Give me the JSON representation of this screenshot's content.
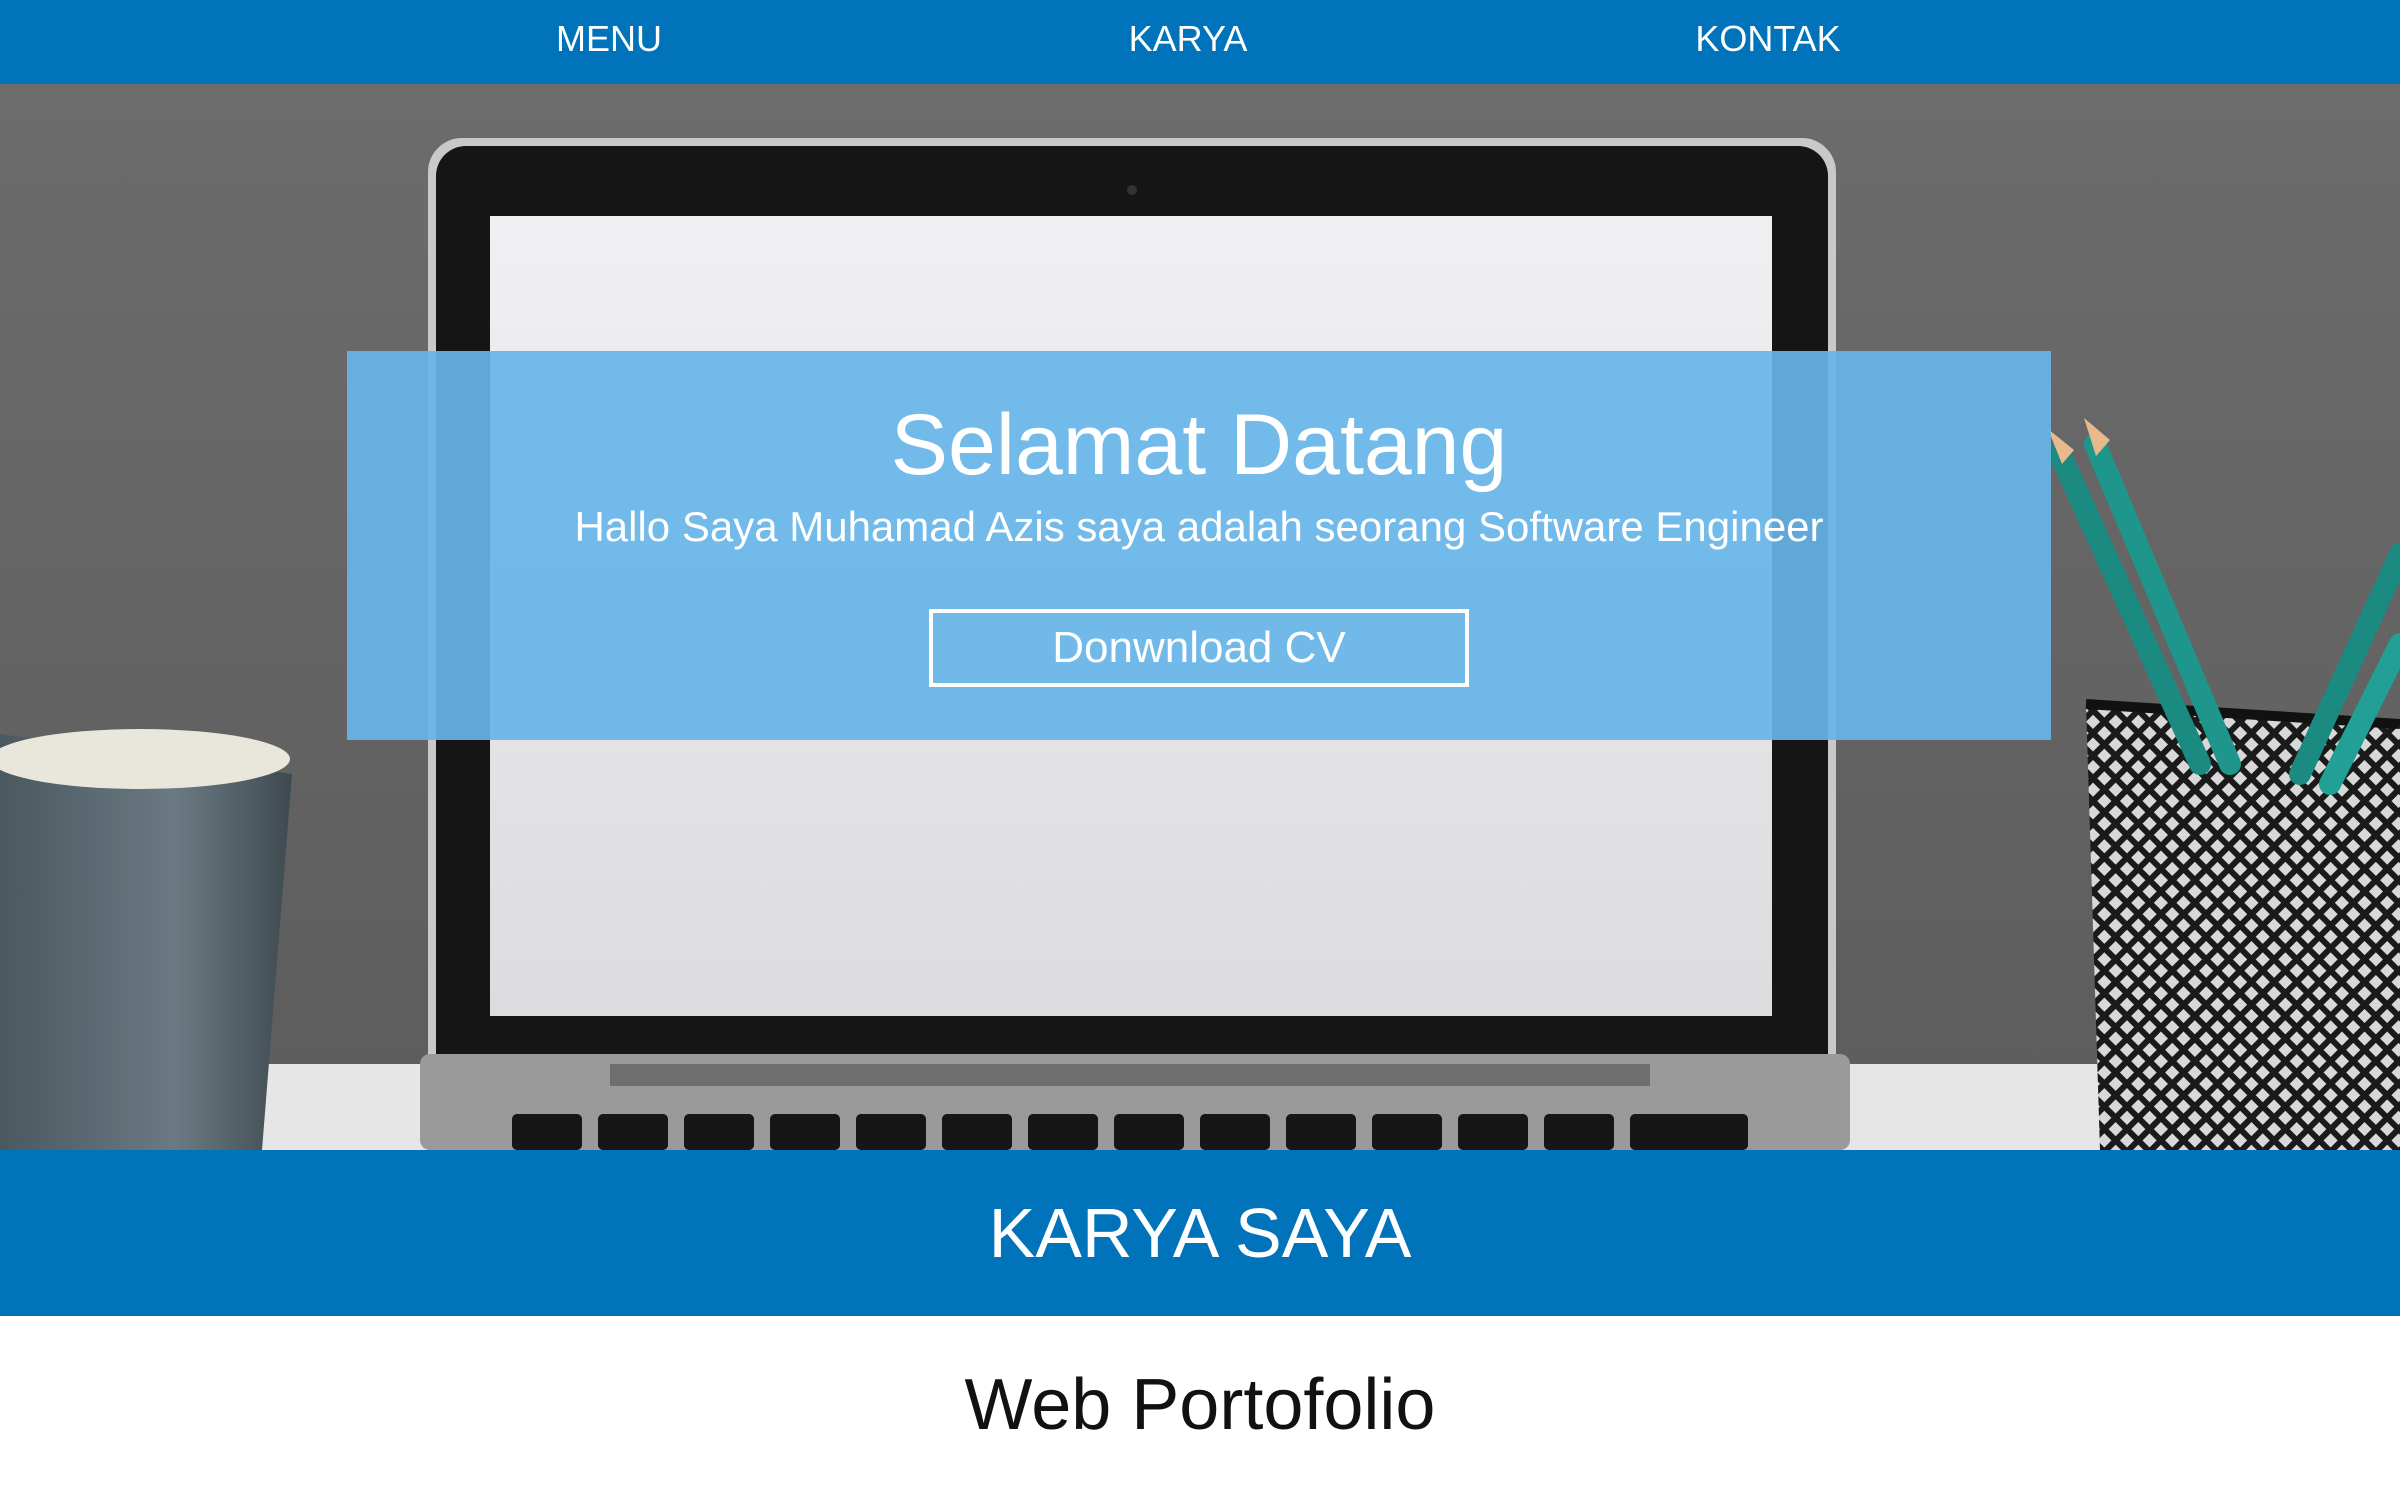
{
  "nav": {
    "items": [
      {
        "label": "MENU"
      },
      {
        "label": "KARYA"
      },
      {
        "label": "KONTAK"
      }
    ]
  },
  "hero": {
    "title": "Selamat Datang",
    "subtitle": "Hallo Saya Muhamad Azis saya adalah seorang Software Engineer",
    "cv_button_label": "Donwnload CV"
  },
  "works": {
    "section_title": "KARYA SAYA",
    "items": [
      {
        "title": "Web Portofolio"
      }
    ]
  },
  "colors": {
    "primary": "#0073bb",
    "overlay": "#67b5e8",
    "text_light": "#ffffff",
    "text_dark": "#111111"
  }
}
